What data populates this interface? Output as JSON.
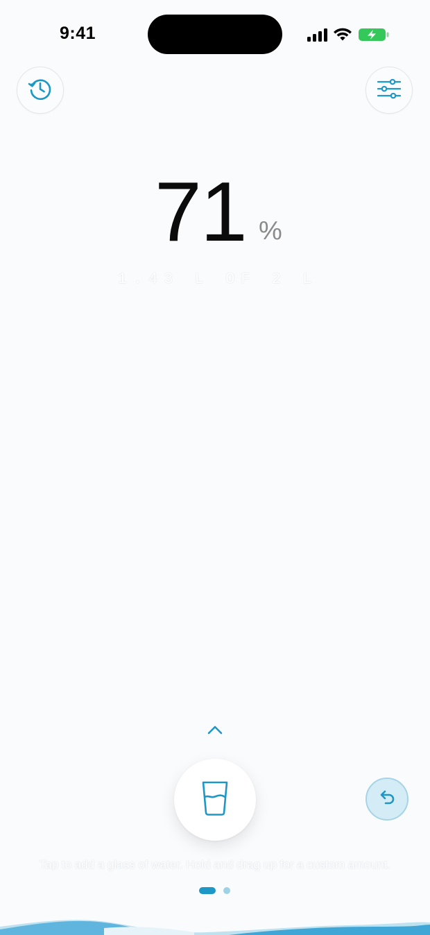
{
  "status_bar": {
    "time": "9:41"
  },
  "header": {
    "history_icon": "history-clock-icon",
    "settings_icon": "sliders-icon"
  },
  "progress": {
    "percent": "71",
    "percent_sign": "%",
    "amount_text": "1.43 L OF 2 L",
    "fraction": 0.71
  },
  "controls": {
    "swipe_up_icon": "chevron-up-icon",
    "add_icon": "water-glass-icon",
    "undo_icon": "undo-arrow-icon",
    "hint": "Tap to add a glass of water. Hold and drag up for a custom amount."
  },
  "pager": {
    "pages": 2,
    "active_page": 1
  },
  "colors": {
    "accent": "#1d97c6",
    "background": "#fafbfd",
    "undo_fill": "#d3ecf5",
    "battery": "#34c759"
  }
}
